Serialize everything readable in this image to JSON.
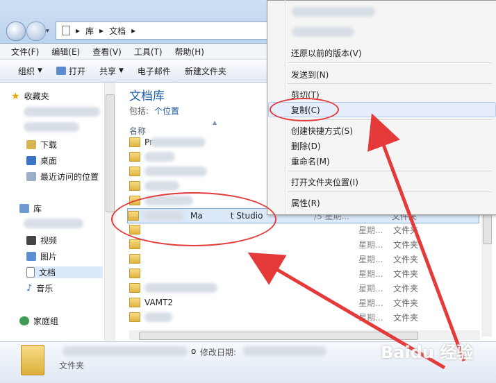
{
  "address": {
    "breadcrumb": [
      "库",
      "文档"
    ],
    "separator": "▸"
  },
  "menubar": [
    "文件(F)",
    "编辑(E)",
    "查看(V)",
    "工具(T)",
    "帮助(H)"
  ],
  "toolbar": {
    "organize": "组织",
    "open": "打开",
    "share": "共享",
    "email": "电子邮件",
    "new_folder": "新建文件夹"
  },
  "nav": {
    "favorites": "收藏夹",
    "downloads": "下载",
    "desktop": "桌面",
    "recent": "最近访问的位置",
    "libraries": "库",
    "videos": "视频",
    "pictures": "图片",
    "documents": "文档",
    "music": "音乐",
    "homegroup": "家庭组"
  },
  "library": {
    "title": "文档库",
    "includes_label": "包括:",
    "locations": "个位置",
    "col_name": "名称"
  },
  "rows": {
    "row0": {
      "name": "Pr"
    },
    "sel_name": "Ma",
    "sel_name_tail": "t Studio",
    "sel_date": "/5 星期...",
    "row_vamt": "VAMT2",
    "date_short": "星期...",
    "type": "文件夹"
  },
  "details": {
    "modified_label": "修改日期:",
    "type": "文件夹",
    "char_o": "o"
  },
  "context_menu": {
    "restore": "还原以前的版本(V)",
    "sendto": "发送到(N)",
    "cut": "剪切(T)",
    "copy": "复制(C)",
    "shortcut": "创建快捷方式(S)",
    "delete": "删除(D)",
    "rename": "重命名(M)",
    "open_location": "打开文件夹位置(I)",
    "properties": "属性(R)"
  },
  "watermark": "Baidu 经验",
  "colors": {
    "accent": "#1e5da8",
    "annotation": "#e53a3a",
    "selection": "#dbe9fb"
  }
}
